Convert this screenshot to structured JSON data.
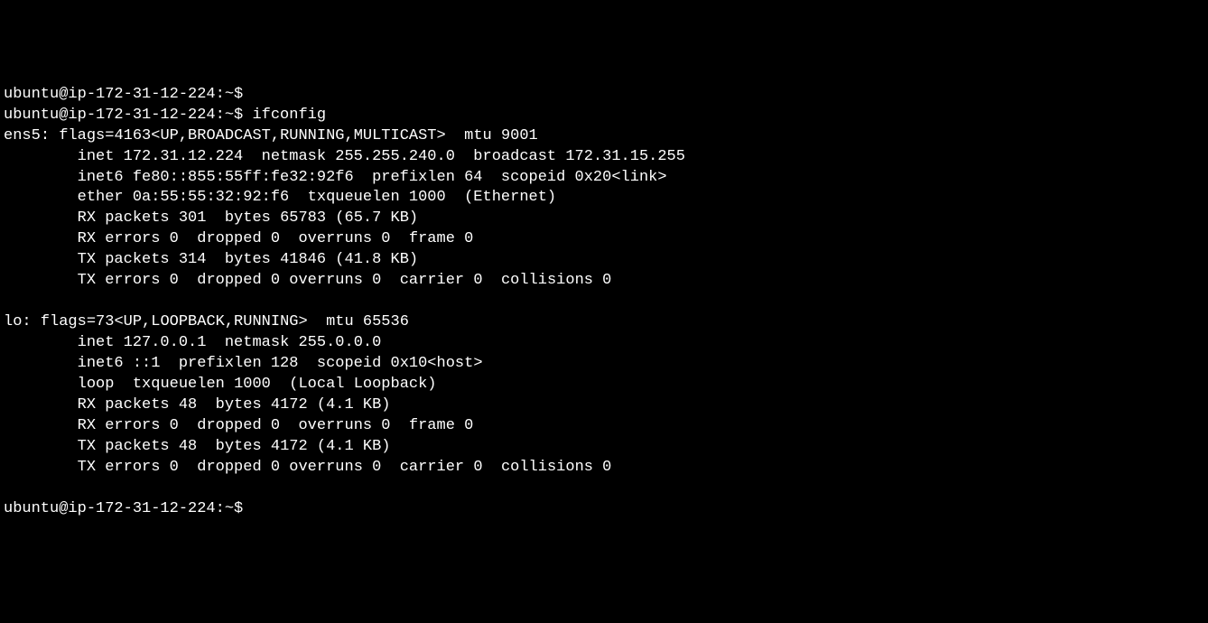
{
  "prompt": "ubuntu@ip-172-31-12-224:~$",
  "command": "ifconfig",
  "interfaces": [
    {
      "name": "ens5",
      "flags_num": "4163",
      "flags_list": "UP,BROADCAST,RUNNING,MULTICAST",
      "mtu": "9001",
      "inet": "172.31.12.224",
      "netmask": "255.255.240.0",
      "broadcast": "172.31.15.255",
      "inet6": "fe80::855:55ff:fe32:92f6",
      "prefixlen": "64",
      "scopeid": "0x20<link>",
      "ether": "0a:55:55:32:92:f6",
      "txqueuelen": "1000",
      "type_label": "(Ethernet)",
      "rx_packets": "301",
      "rx_bytes": "65783 (65.7 KB)",
      "rx_errors": "0",
      "rx_dropped": "0",
      "rx_overruns": "0",
      "rx_frame": "0",
      "tx_packets": "314",
      "tx_bytes": "41846 (41.8 KB)",
      "tx_errors": "0",
      "tx_dropped": "0",
      "tx_overruns": "0",
      "tx_carrier": "0",
      "tx_collisions": "0"
    },
    {
      "name": "lo",
      "flags_num": "73",
      "flags_list": "UP,LOOPBACK,RUNNING",
      "mtu": "65536",
      "inet": "127.0.0.1",
      "netmask": "255.0.0.0",
      "inet6": "::1",
      "prefixlen": "128",
      "scopeid": "0x10<host>",
      "loop": "loop",
      "txqueuelen": "1000",
      "type_label": "(Local Loopback)",
      "rx_packets": "48",
      "rx_bytes": "4172 (4.1 KB)",
      "rx_errors": "0",
      "rx_dropped": "0",
      "rx_overruns": "0",
      "rx_frame": "0",
      "tx_packets": "48",
      "tx_bytes": "4172 (4.1 KB)",
      "tx_errors": "0",
      "tx_dropped": "0",
      "tx_overruns": "0",
      "tx_carrier": "0",
      "tx_collisions": "0"
    }
  ]
}
